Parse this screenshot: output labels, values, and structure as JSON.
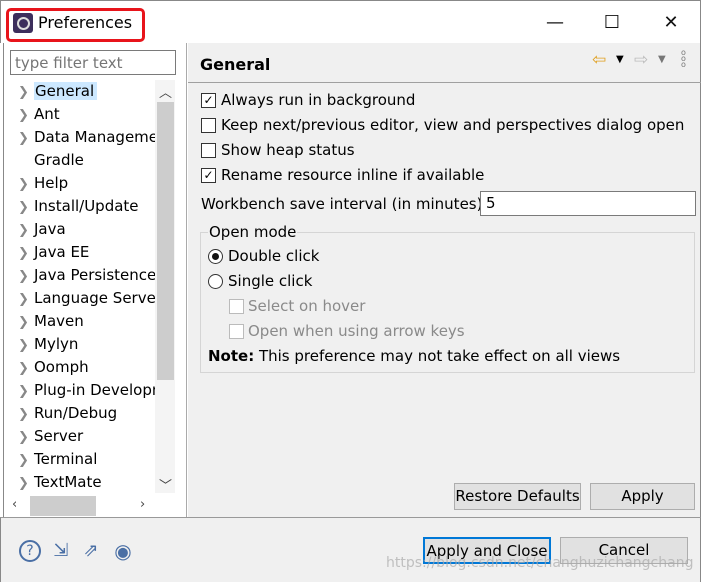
{
  "window": {
    "title": "Preferences",
    "minimize": "—",
    "maximize": "☐",
    "close": "✕"
  },
  "sidebar": {
    "filter_placeholder": "type filter text",
    "items": [
      {
        "label": "General",
        "expandable": true,
        "selected": true
      },
      {
        "label": "Ant",
        "expandable": true
      },
      {
        "label": "Data Management",
        "expandable": true
      },
      {
        "label": "Gradle",
        "expandable": false
      },
      {
        "label": "Help",
        "expandable": true
      },
      {
        "label": "Install/Update",
        "expandable": true
      },
      {
        "label": "Java",
        "expandable": true
      },
      {
        "label": "Java EE",
        "expandable": true
      },
      {
        "label": "Java Persistence",
        "expandable": true
      },
      {
        "label": "Language Servers",
        "expandable": true
      },
      {
        "label": "Maven",
        "expandable": true
      },
      {
        "label": "Mylyn",
        "expandable": true
      },
      {
        "label": "Oomph",
        "expandable": true
      },
      {
        "label": "Plug-in Development",
        "expandable": true
      },
      {
        "label": "Run/Debug",
        "expandable": true
      },
      {
        "label": "Server",
        "expandable": true
      },
      {
        "label": "Terminal",
        "expandable": true
      },
      {
        "label": "TextMate",
        "expandable": true
      }
    ]
  },
  "page": {
    "title": "General",
    "options": [
      {
        "label": "Always run in background",
        "checked": true
      },
      {
        "label": "Keep next/previous editor, view and perspectives dialog open",
        "checked": false
      },
      {
        "label": "Show heap status",
        "checked": false
      },
      {
        "label": "Rename resource inline if available",
        "checked": true
      }
    ],
    "interval_label": "Workbench save interval (in minutes):",
    "interval_value": "5",
    "open_mode": {
      "title": "Open mode",
      "double": "Double click",
      "single": "Single click",
      "selected": "Double click",
      "hover": "Select on hover",
      "arrow": "Open when using arrow keys"
    },
    "note_bold": "Note:",
    "note": " This preference may not take effect on all views",
    "restore": "Restore Defaults",
    "apply": "Apply"
  },
  "footer": {
    "apply_close": "Apply and Close",
    "cancel": "Cancel",
    "watermark": "https://blog.csdn.net/changhuzichangchang"
  },
  "colors": {
    "selection": "#cce8ff",
    "highlight_border": "#e8141b",
    "default_button_border": "#0078d7"
  }
}
